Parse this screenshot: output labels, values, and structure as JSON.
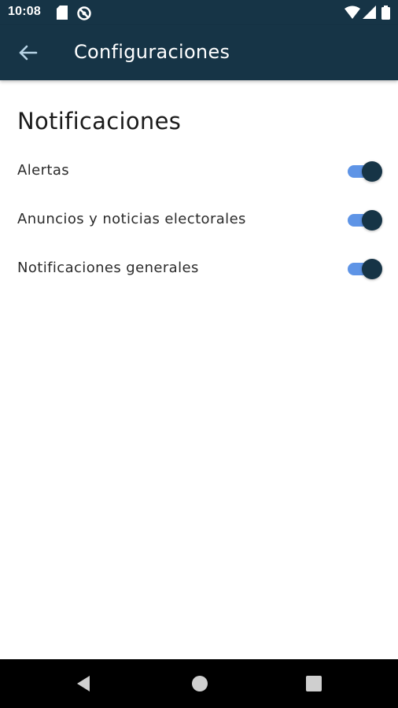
{
  "status_bar": {
    "time": "10:08",
    "icons": [
      "sd-card-icon",
      "sync-blocked-icon",
      "wifi-icon",
      "signal-icon",
      "battery-icon"
    ]
  },
  "app_bar": {
    "title": "Configuraciones",
    "back_icon": "arrow-left-icon"
  },
  "section": {
    "title": "Notificaciones"
  },
  "settings": [
    {
      "label": "Alertas",
      "enabled": true
    },
    {
      "label": "Anuncios y noticias electorales",
      "enabled": true
    },
    {
      "label": "Notificaciones generales",
      "enabled": true
    }
  ],
  "nav_bar": {
    "buttons": [
      "back-triangle-icon",
      "home-circle-icon",
      "recents-square-icon"
    ]
  },
  "colors": {
    "primary": "#163446",
    "switch_track": "#5e94e6",
    "switch_thumb": "#163446"
  }
}
